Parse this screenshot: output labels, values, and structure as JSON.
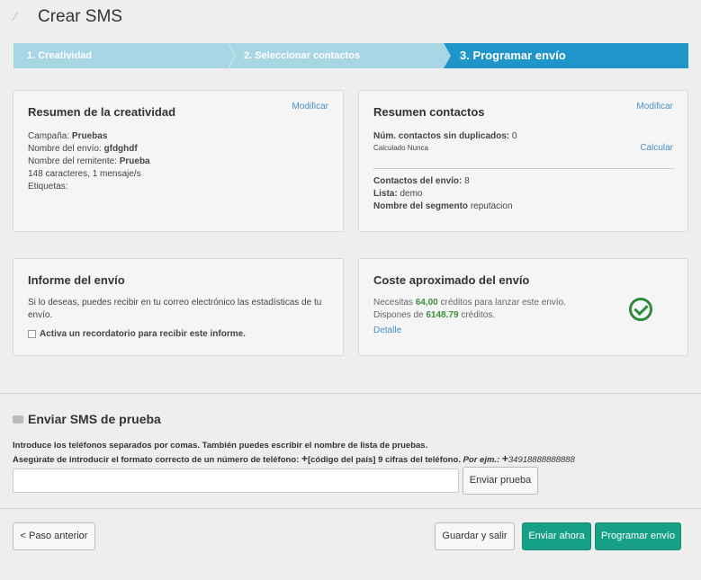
{
  "header": {
    "title": "Crear SMS",
    "icon": "magic-wand-icon"
  },
  "steps": [
    {
      "label": "1. Creatividad"
    },
    {
      "label": "2. Seleccionar contactos"
    },
    {
      "label": "3. Programar envío"
    }
  ],
  "creatividad": {
    "title": "Resumen de la creatividad",
    "modify": "Modificar",
    "campaign_label": "Campaña:",
    "campaign_value": "Pruebas",
    "sendname_label": "Nombre del envío:",
    "sendname_value": "gfdghdf",
    "sender_label": "Nombre del remitente:",
    "sender_value": "Prueba",
    "chars": "148 caracteres, 1 mensaje/s",
    "tags_label": "Etiquetas:"
  },
  "contactos": {
    "title": "Resumen contactos",
    "modify": "Modificar",
    "unique_label": "Núm. contactos sin duplicados:",
    "unique_value": "0",
    "calc_status": "Calculado Nunca",
    "calc_link": "Calcular",
    "send_contacts_label": "Contactos del envío:",
    "send_contacts_value": "8",
    "list_label": "Lista:",
    "list_value": "demo",
    "segment_label": "Nombre del segmento",
    "segment_value": "reputacion"
  },
  "informe": {
    "title": "Informe del envío",
    "text": "Si lo deseas, puedes recibir en tu correo electrónico las estadísticas de tu envío.",
    "checkbox_label": "Activa un recordatorio para recibir este informe."
  },
  "coste": {
    "title": "Coste aproximado del envío",
    "line1_pre": "Necesitas",
    "line1_value": "64,00",
    "line1_post": "créditos para lanzar este envío.",
    "line2_pre": "Dispones de",
    "line2_value": "6148.79",
    "line2_post": "créditos.",
    "detail_link": "Detalle"
  },
  "test": {
    "title": "Enviar SMS de prueba",
    "instruction1": "Introduce los teléfonos separados por comas. También puedes escribir el nombre de lista de pruebas.",
    "instruction2_pre": "Asegúrate de introducir el formato correcto de un número de teléfono:",
    "instruction2_plus1": "+",
    "instruction2_mid": "[código del país] 9 cifras del teléfono.",
    "instruction2_example": "Por ejm.:",
    "instruction2_plus2": "+",
    "instruction2_number": "34918888888888",
    "phone_value": "",
    "send_button": "Enviar prueba"
  },
  "footer": {
    "prev": "< Paso anterior",
    "save": "Guardar y salir",
    "send_now": "Enviar ahora",
    "schedule": "Programar envío"
  }
}
